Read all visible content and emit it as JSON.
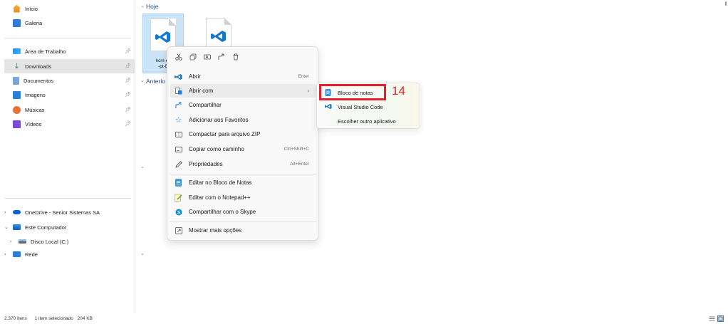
{
  "sidebar": {
    "quick": [
      {
        "label": "Início",
        "icon": "home-icon"
      },
      {
        "label": "Galeria",
        "icon": "gallery-icon"
      }
    ],
    "pinned": [
      {
        "label": "Área de Trabalho",
        "icon": "desktop-icon"
      },
      {
        "label": "Downloads",
        "icon": "download-icon"
      },
      {
        "label": "Documentos",
        "icon": "documents-icon"
      },
      {
        "label": "Imagens",
        "icon": "pictures-icon"
      },
      {
        "label": "Músicas",
        "icon": "music-icon"
      },
      {
        "label": "Vídeos",
        "icon": "videos-icon"
      }
    ],
    "tree": [
      {
        "label": "OneDrive - Senior Sistemas SA",
        "icon": "onedrive-icon"
      },
      {
        "label": "Este Computador",
        "icon": "computer-icon"
      },
      {
        "label": "Disco Local (C:)",
        "icon": "drive-icon"
      },
      {
        "label": "Rede",
        "icon": "network-icon"
      }
    ],
    "selected": "Downloads"
  },
  "main": {
    "group_today": "Hoje",
    "group_earlier": "Anterio",
    "files": [
      {
        "name_line1": "hcm-onl",
        "name_line2": "-pt-BI",
        "selected": true
      },
      {
        "name_line1": "",
        "name_line2": "",
        "selected": false
      }
    ]
  },
  "context_menu": {
    "toolbar": [
      "cut-icon",
      "copy-icon",
      "rename-icon",
      "share-icon",
      "delete-icon"
    ],
    "items": [
      {
        "label": "Abrir",
        "shortcut": "Enter",
        "icon": "vscode-icon"
      },
      {
        "label": "Abrir com",
        "shortcut": "",
        "icon": "open-with-icon",
        "submenu": true
      },
      {
        "label": "Compartilhar",
        "shortcut": "",
        "icon": "share-icon"
      },
      {
        "label": "Adicionar aos Favoritos",
        "shortcut": "",
        "icon": "star-icon"
      },
      {
        "label": "Compactar para arquivo ZIP",
        "shortcut": "",
        "icon": "zip-icon"
      },
      {
        "label": "Copiar como caminho",
        "shortcut": "Ctrl+Shift+C",
        "icon": "path-icon"
      },
      {
        "label": "Propriedades",
        "shortcut": "Alt+Enter",
        "icon": "properties-icon"
      },
      {
        "label": "Editar no Bloco de Notas",
        "shortcut": "",
        "icon": "notepad-icon"
      },
      {
        "label": "Editar com o Notepad++",
        "shortcut": "",
        "icon": "notepadpp-icon"
      },
      {
        "label": "Compartilhar com o Skype",
        "shortcut": "",
        "icon": "skype-icon"
      },
      {
        "label": "Mostrar mais opções",
        "shortcut": "",
        "icon": "more-options-icon"
      }
    ]
  },
  "submenu": {
    "items": [
      {
        "label": "Bloco de notas",
        "icon": "notepad-icon"
      },
      {
        "label": "Visual Studio Code",
        "icon": "vscode-icon"
      },
      {
        "label": "Escolher outro aplicativo",
        "icon": ""
      }
    ]
  },
  "annotation": {
    "step": "14",
    "color": "#e0212b"
  },
  "status": {
    "items_count": "2.370 itens",
    "selected_info": "1 item selecionado",
    "size": "204 KB"
  }
}
